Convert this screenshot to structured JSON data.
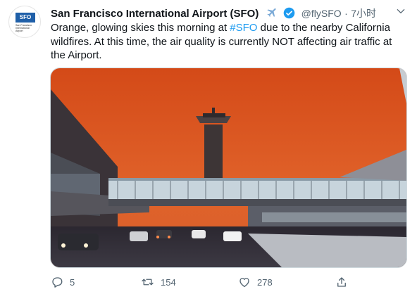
{
  "avatar": {
    "logo_text": "SFO",
    "logo_lines": [
      "San Francisco",
      "International",
      "Airport"
    ]
  },
  "header": {
    "display_name": "San Francisco International Airport (SFO)",
    "handle": "@flySFO",
    "separator": "·",
    "time": "7小时"
  },
  "tweet": {
    "text_before": "Orange, glowing skies this morning at ",
    "hashtag": "#SFO",
    "text_after": " due to the nearby California wildfires. At this time, the air quality is currently NOT affecting air traffic at the Airport."
  },
  "photo": {
    "description_alt": "SFO control tower under an orange sky",
    "sky_color": "#d9531e"
  },
  "actions": {
    "reply_count": "5",
    "retweet_count": "154",
    "like_count": "278"
  },
  "colors": {
    "accent": "#1d9bf0",
    "muted": "#536471",
    "text": "#0f1419"
  },
  "icons": [
    "airplane-icon",
    "verified-icon",
    "chevron-down-icon",
    "reply-icon",
    "retweet-icon",
    "like-icon",
    "share-icon"
  ]
}
